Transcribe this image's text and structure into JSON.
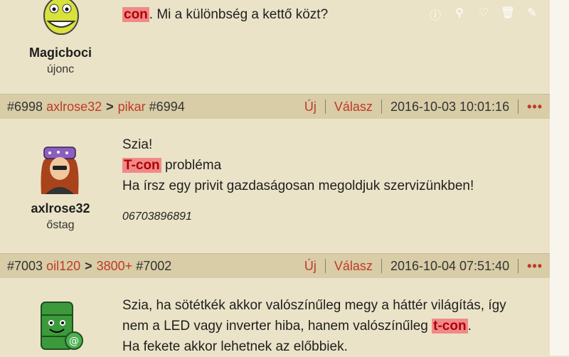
{
  "post1": {
    "text_highlight": "con",
    "text_rest": ". Mi a különbség a kettő közt?",
    "author_name": "Magicboci",
    "author_rank": "újonc"
  },
  "header1": {
    "num": "#6998",
    "user": "axlrose32",
    "arrow": ">",
    "reply_user": "pikar",
    "reply_num": "#6994",
    "new_label": "Új",
    "reply_label": "Válasz",
    "date": "2016-10-03 10:01:16",
    "more": "•••"
  },
  "post2": {
    "author_name": "axlrose32",
    "author_rank": "őstag",
    "line1": "Szia!",
    "line2_highlight": "T-con",
    "line2_rest": " probléma",
    "line3": "Ha írsz egy privit gazdaságosan megoldjuk szervizünkben!",
    "signature": "06703896891"
  },
  "header2": {
    "num": "#7003",
    "user": "oil120",
    "arrow": ">",
    "reply_user": "3800+",
    "reply_num": "#7002",
    "new_label": "Új",
    "reply_label": "Válasz",
    "date": "2016-10-04 07:51:40",
    "more": "•••"
  },
  "post3": {
    "line1": "Szia, ha sötétkék akkor valószínűleg megy a háttér világítás, így",
    "line2_start": "nem a LED vagy inverter hiba, hanem valószínűleg ",
    "line2_highlight": "t-con",
    "line2_end": ".",
    "line3": "Ha fekete akkor lehetnek az előbbiek."
  },
  "colors": {
    "accent": "#c0392b",
    "highlight": "#f08a8a",
    "header_bg": "#d8cda6",
    "body_bg": "#ebe3c7"
  }
}
